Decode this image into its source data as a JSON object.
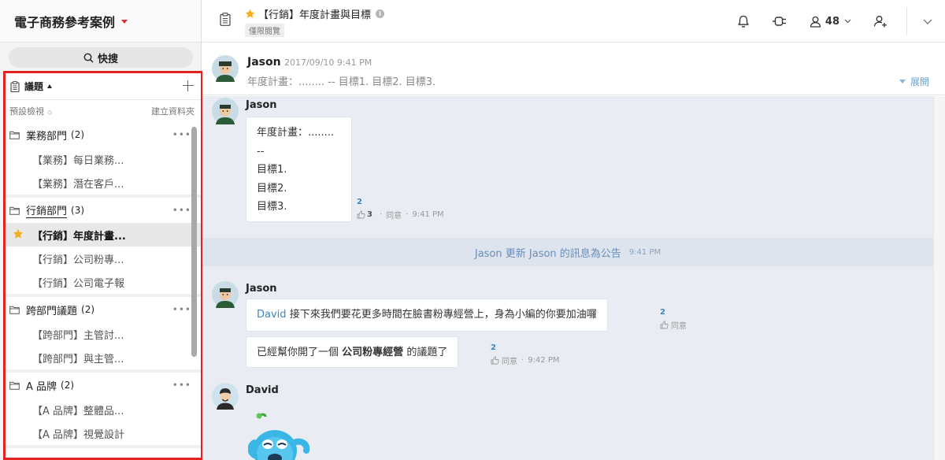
{
  "workspace": {
    "title": "電子商務參考案例"
  },
  "search": {
    "label": "快搜"
  },
  "topics_panel": {
    "title": "議題",
    "view_label": "預設檢視",
    "create_folder_label": "建立資料夾",
    "folders": [
      {
        "name": "業務部門",
        "count": "(2)",
        "topics": [
          {
            "label": "【業務】每日業務..."
          },
          {
            "label": "【業務】潛在客戶..."
          }
        ]
      },
      {
        "name": "行銷部門",
        "count": "(3)",
        "topics": [
          {
            "label": "【行銷】年度計畫..."
          },
          {
            "label": "【行銷】公司粉專..."
          },
          {
            "label": "【行銷】公司電子報"
          }
        ]
      },
      {
        "name": "跨部門議題",
        "count": "(2)",
        "topics": [
          {
            "label": "【跨部門】主管討..."
          },
          {
            "label": "【跨部門】與主管..."
          }
        ]
      },
      {
        "name": "A 品牌",
        "count": "(2)",
        "topics": [
          {
            "label": "【A 品牌】整體品..."
          },
          {
            "label": "【A 品牌】視覺設計"
          }
        ]
      }
    ]
  },
  "header": {
    "topic_title": "【行銷】年度計畫與目標",
    "permission_badge": "僅限閱覽",
    "member_count": "48"
  },
  "announcement": {
    "author": "Jason",
    "time": "2017/09/10 9:41 PM",
    "text": "年度計畫：........ -- 目標1. 目標2. 目標3.",
    "expand_label": "展開"
  },
  "messages": {
    "m1": {
      "author": "Jason",
      "lines": [
        "年度計畫：........",
        "--",
        "目標1.",
        "目標2.",
        "目標3."
      ],
      "read_count": "2",
      "like_count": "3",
      "like_label": "同意",
      "time": "9:41 PM"
    },
    "system": {
      "text": "Jason 更新 Jason 的訊息為公告",
      "time": "9:41 PM"
    },
    "m2": {
      "author": "Jason",
      "b1_mention": "David",
      "b1_text": "接下來我們要花更多時間在臉書粉專經營上，身為小編的你要加油囉",
      "b1_read": "2",
      "b1_like_label": "同意",
      "b2_prefix": "已經幫你開了一個",
      "b2_bold": "公司粉專經營",
      "b2_suffix": "的議題了",
      "b2_read": "2",
      "b2_like_label": "同意",
      "b2_time": "9:42 PM"
    },
    "m3": {
      "author": "David"
    }
  },
  "colors": {
    "highlight_border": "#e42222",
    "star": "#f2b01e",
    "link": "#3b86c6",
    "chat_bg": "#e9edf3"
  }
}
